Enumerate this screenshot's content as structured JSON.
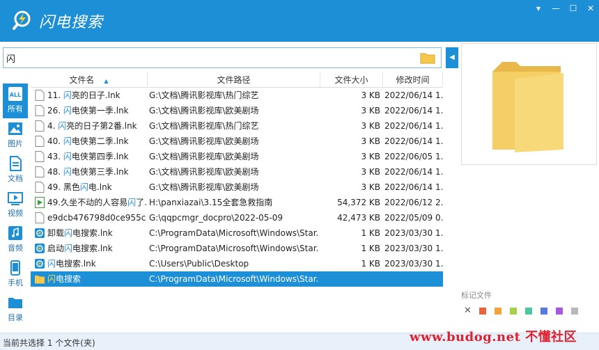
{
  "app": {
    "title": "闪电搜索"
  },
  "window_controls": {
    "menu": "▾",
    "minimize": "—",
    "maximize": "☐",
    "close": "✕"
  },
  "search": {
    "value": "闪"
  },
  "sidebar": {
    "items": [
      {
        "label": "所有",
        "icon": "all-icon"
      },
      {
        "label": "图片",
        "icon": "image-icon"
      },
      {
        "label": "文档",
        "icon": "document-icon"
      },
      {
        "label": "视频",
        "icon": "video-icon"
      },
      {
        "label": "音频",
        "icon": "audio-icon"
      },
      {
        "label": "手机",
        "icon": "phone-icon"
      },
      {
        "label": "目录",
        "icon": "folder-icon"
      }
    ],
    "all_badge": "ALL"
  },
  "table": {
    "headers": {
      "name": "文件名",
      "path": "文件路径",
      "size": "文件大小",
      "time": "修改时间"
    },
    "rows": [
      {
        "name_pre": "11. ",
        "name_hl": "闪",
        "name_post": "亮的日子.lnk",
        "path": "G:\\文档\\腾讯影视库\\热门综艺",
        "size": "3 KB",
        "time": "2022/06/14 1...",
        "icon": "file-icon"
      },
      {
        "name_pre": "26. ",
        "name_hl": "闪",
        "name_post": "电侠第一季.lnk",
        "path": "G:\\文档\\腾讯影视库\\欧美剧场",
        "size": "3 KB",
        "time": "2022/06/14 1...",
        "icon": "file-icon"
      },
      {
        "name_pre": "4. ",
        "name_hl": "闪",
        "name_post": "亮的日子第2番.lnk",
        "path": "G:\\文档\\腾讯影视库\\热门综艺",
        "size": "3 KB",
        "time": "2022/06/14 1...",
        "icon": "file-icon"
      },
      {
        "name_pre": "40. ",
        "name_hl": "闪",
        "name_post": "电侠第二季.lnk",
        "path": "G:\\文档\\腾讯影视库\\欧美剧场",
        "size": "3 KB",
        "time": "2022/06/14 1...",
        "icon": "file-icon"
      },
      {
        "name_pre": "43. ",
        "name_hl": "闪",
        "name_post": "电侠第四季.lnk",
        "path": "G:\\文档\\腾讯影视库\\欧美剧场",
        "size": "3 KB",
        "time": "2022/06/05 1...",
        "icon": "file-icon"
      },
      {
        "name_pre": "48. ",
        "name_hl": "闪",
        "name_post": "电侠第三季.lnk",
        "path": "G:\\文档\\腾讯影视库\\欧美剧场",
        "size": "3 KB",
        "time": "2022/06/14 1...",
        "icon": "file-icon"
      },
      {
        "name_pre": "49. 黑色",
        "name_hl": "闪",
        "name_post": "电.lnk",
        "path": "G:\\文档\\腾讯影视库\\欧美剧场",
        "size": "3 KB",
        "time": "2022/06/14 1...",
        "icon": "file-icon"
      },
      {
        "name_pre": "49.久坐不动的人容易",
        "name_hl": "闪",
        "name_post": "了...",
        "path": "H:\\panxiazai\\3.15全套急救指南",
        "size": "54,372 KB",
        "time": "2022/06/12 2...",
        "icon": "video-file-icon"
      },
      {
        "name_pre": "e9dcb476798d0ce955c...",
        "name_hl": "",
        "name_post": "",
        "path": "G:\\qqpcmgr_docpro\\2022-05-09",
        "size": "42,473 KB",
        "time": "2022/05/09 0...",
        "icon": "file-icon"
      },
      {
        "name_pre": "卸载",
        "name_hl": "闪",
        "name_post": "电搜索.lnk",
        "path": "C:\\ProgramData\\Microsoft\\Windows\\Star...",
        "size": "1 KB",
        "time": "2023/03/30 1...",
        "icon": "app-shortcut-icon"
      },
      {
        "name_pre": "启动",
        "name_hl": "闪",
        "name_post": "电搜索.lnk",
        "path": "C:\\ProgramData\\Microsoft\\Windows\\Star...",
        "size": "1 KB",
        "time": "2023/03/30 1...",
        "icon": "app-shortcut-icon"
      },
      {
        "name_pre": "",
        "name_hl": "闪",
        "name_post": "电搜索.lnk",
        "path": "C:\\Users\\Public\\Desktop",
        "size": "1 KB",
        "time": "2023/03/30 1...",
        "icon": "app-shortcut-icon"
      },
      {
        "name_pre": "",
        "name_hl": "闪",
        "name_post": "电搜索",
        "path": "C:\\ProgramData\\Microsoft\\Windows\\Star...",
        "size": "",
        "time": "",
        "icon": "folder-icon",
        "selected": true
      }
    ]
  },
  "tags": {
    "label": "标记文件",
    "colors": [
      "#e8643c",
      "#f0a33a",
      "#a6d04a",
      "#4cc7a0",
      "#5a78e0",
      "#a45ad8",
      "#b8b8b8"
    ]
  },
  "status": {
    "text": "当前共选择 1 个文件(夹)"
  },
  "watermark": {
    "text": "www.budog.net 不懂社区"
  },
  "colors": {
    "accent": "#1d8fd6",
    "highlight": "#2a8de0",
    "folder": "#f5c84c"
  }
}
